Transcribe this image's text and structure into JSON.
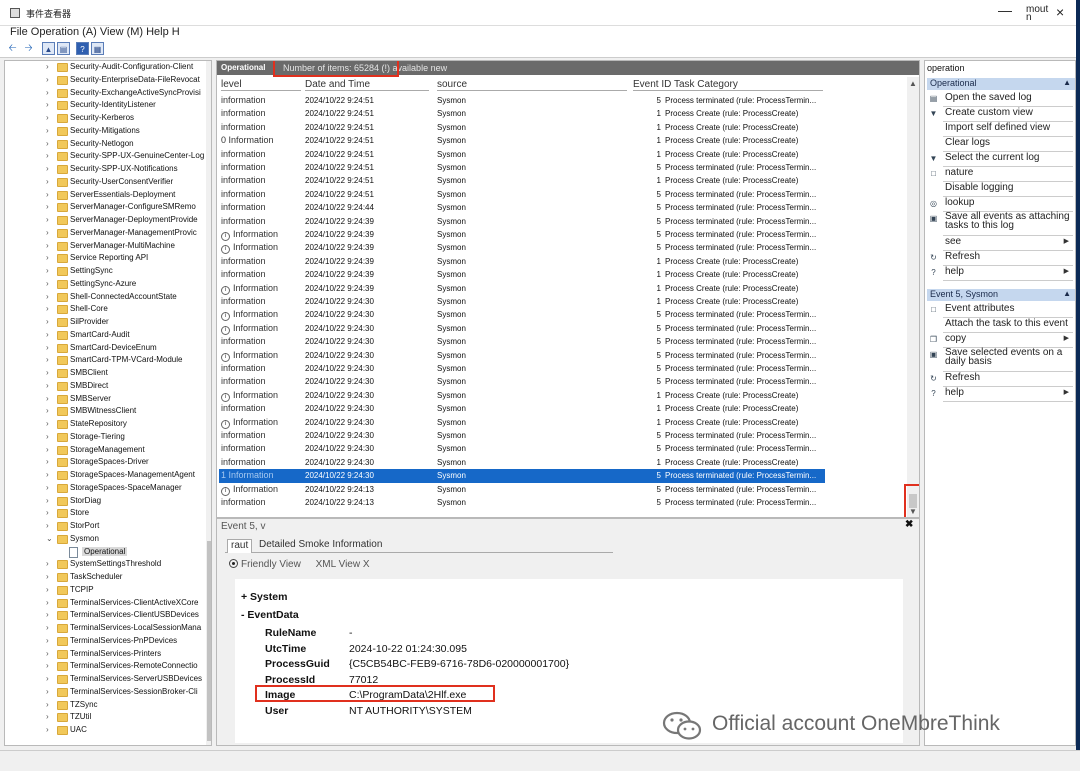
{
  "window": {
    "title": "事件查看器",
    "controls": {
      "minimize": "—",
      "maximize": "mout",
      "maximize_sub": "n",
      "close": "×"
    }
  },
  "menu": "File Operation (A) View (M) Help H",
  "toolbar": {
    "icons": [
      "back-arrow-icon",
      "forward-arrow-icon",
      "folder-up-icon",
      "show-hide-pane-icon",
      "help-icon",
      "properties-icon"
    ]
  },
  "tree": {
    "items": [
      "Security-Audit-Configuration-Client",
      "Security-EnterpriseData-FileRevocat",
      "Security-ExchangeActiveSyncProvisi",
      "Security-IdentityListener",
      "Security-Kerberos",
      "Security-Mitigations",
      "Security-Netlogon",
      "Security-SPP-UX-GenuineCenter-Log",
      "Security-SPP-UX-Notifications",
      "Security-UserConsentVerifier",
      "ServerEssentials-Deployment",
      "ServerManager-ConfigureSMRemo",
      "ServerManager-DeploymentProvide",
      "ServerManager-ManagementProvic",
      "ServerManager-MultiMachine",
      "Service Reporting API",
      "SettingSync",
      "SettingSync-Azure",
      "Shell-ConnectedAccountState",
      "Shell-Core",
      "SilProvider",
      "SmartCard-Audit",
      "SmartCard-DeviceEnum",
      "SmartCard-TPM-VCard-Module",
      "SMBClient",
      "SMBDirect",
      "SMBServer",
      "SMBWitnessClient",
      "StateRepository",
      "Storage-Tiering",
      "StorageManagement",
      "StorageSpaces-Driver",
      "StorageSpaces-ManagementAgent",
      "StorageSpaces-SpaceManager",
      "StorDiag",
      "Store",
      "StorPort",
      "Sysmon"
    ],
    "selected_child": "Operational",
    "items_after": [
      "SystemSettingsThreshold",
      "TaskScheduler",
      "TCPIP",
      "TerminalServices-ClientActiveXCore",
      "TerminalServices-ClientUSBDevices",
      "TerminalServices-LocalSessionMana",
      "TerminalServices-PnPDevices",
      "TerminalServices-Printers",
      "TerminalServices-RemoteConnectio",
      "TerminalServices-ServerUSBDevices",
      "TerminalServices-SessionBroker-Cli",
      "TZSync",
      "TZUtil",
      "UAC"
    ]
  },
  "log": {
    "tab": "Operational",
    "count": "Number of items: 65284 (!) available new",
    "columns": {
      "level": "level",
      "date": "Date and Time",
      "source": "source",
      "id_task": "Event ID Task Category"
    },
    "rows": [
      {
        "level": "information",
        "icon": false,
        "date": "2024/10/22 9:24:51",
        "source": "Sysmon",
        "id": "5",
        "task": "Process terminated (rule: ProcessTermin..."
      },
      {
        "level": "information",
        "icon": false,
        "date": "2024/10/22 9:24:51",
        "source": "Sysmon",
        "id": "1",
        "task": "Process Create (rule: ProcessCreate)"
      },
      {
        "level": "information",
        "icon": false,
        "date": "2024/10/22 9:24:51",
        "source": "Sysmon",
        "id": "1",
        "task": "Process Create (rule: ProcessCreate)"
      },
      {
        "level": "0 Information",
        "icon": false,
        "date": "2024/10/22 9:24:51",
        "source": "Sysmon",
        "id": "1",
        "task": "Process Create (rule: ProcessCreate)"
      },
      {
        "level": "information",
        "icon": false,
        "date": "2024/10/22 9:24:51",
        "source": "Sysmon",
        "id": "1",
        "task": "Process Create (rule: ProcessCreate)"
      },
      {
        "level": "information",
        "icon": false,
        "date": "2024/10/22 9:24:51",
        "source": "Sysmon",
        "id": "5",
        "task": "Process terminated (rule: ProcessTermin..."
      },
      {
        "level": "information",
        "icon": false,
        "date": "2024/10/22 9:24:51",
        "source": "Sysmon",
        "id": "1",
        "task": "Process Create (rule: ProcessCreate)"
      },
      {
        "level": "information",
        "icon": false,
        "date": "2024/10/22 9:24:51",
        "source": "Sysmon",
        "id": "5",
        "task": "Process terminated (rule: ProcessTermin..."
      },
      {
        "level": "information",
        "icon": false,
        "date": "2024/10/22 9:24:44",
        "source": "Sysmon",
        "id": "5",
        "task": "Process terminated (rule: ProcessTermin..."
      },
      {
        "level": "information",
        "icon": false,
        "date": "2024/10/22 9:24:39",
        "source": "Sysmon",
        "id": "5",
        "task": "Process terminated (rule: ProcessTermin..."
      },
      {
        "level": "Information",
        "icon": true,
        "date": "2024/10/22 9:24:39",
        "source": "Sysmon",
        "id": "5",
        "task": "Process terminated (rule: ProcessTermin..."
      },
      {
        "level": "Information",
        "icon": true,
        "date": "2024/10/22 9:24:39",
        "source": "Sysmon",
        "id": "5",
        "task": "Process terminated (rule: ProcessTermin..."
      },
      {
        "level": "information",
        "icon": false,
        "date": "2024/10/22 9:24:39",
        "source": "Sysmon",
        "id": "1",
        "task": "Process Create (rule: ProcessCreate)"
      },
      {
        "level": "information",
        "icon": false,
        "date": "2024/10/22 9:24:39",
        "source": "Sysmon",
        "id": "1",
        "task": "Process Create (rule: ProcessCreate)"
      },
      {
        "level": "Information",
        "icon": true,
        "date": "2024/10/22 9:24:39",
        "source": "Sysmon",
        "id": "1",
        "task": "Process Create (rule: ProcessCreate)"
      },
      {
        "level": "information",
        "icon": false,
        "date": "2024/10/22 9:24:30",
        "source": "Sysmon",
        "id": "1",
        "task": "Process Create (rule: ProcessCreate)"
      },
      {
        "level": "Information",
        "icon": true,
        "date": "2024/10/22 9:24:30",
        "source": "Sysmon",
        "id": "5",
        "task": "Process terminated (rule: ProcessTermin..."
      },
      {
        "level": "Information",
        "icon": true,
        "date": "2024/10/22 9:24:30",
        "source": "Sysmon",
        "id": "5",
        "task": "Process terminated (rule: ProcessTermin..."
      },
      {
        "level": "information",
        "icon": false,
        "date": "2024/10/22 9:24:30",
        "source": "Sysmon",
        "id": "5",
        "task": "Process terminated (rule: ProcessTermin..."
      },
      {
        "level": "Information",
        "icon": true,
        "date": "2024/10/22 9:24:30",
        "source": "Sysmon",
        "id": "5",
        "task": "Process terminated (rule: ProcessTermin..."
      },
      {
        "level": "information",
        "icon": false,
        "date": "2024/10/22 9:24:30",
        "source": "Sysmon",
        "id": "5",
        "task": "Process terminated (rule: ProcessTermin..."
      },
      {
        "level": "information",
        "icon": false,
        "date": "2024/10/22 9:24:30",
        "source": "Sysmon",
        "id": "5",
        "task": "Process terminated (rule: ProcessTermin..."
      },
      {
        "level": "Information",
        "icon": true,
        "date": "2024/10/22 9:24:30",
        "source": "Sysmon",
        "id": "1",
        "task": "Process Create (rule: ProcessCreate)"
      },
      {
        "level": "information",
        "icon": false,
        "date": "2024/10/22 9:24:30",
        "source": "Sysmon",
        "id": "1",
        "task": "Process Create (rule: ProcessCreate)"
      },
      {
        "level": "Information",
        "icon": true,
        "date": "2024/10/22 9:24:30",
        "source": "Sysmon",
        "id": "1",
        "task": "Process Create (rule: ProcessCreate)"
      },
      {
        "level": "information",
        "icon": false,
        "date": "2024/10/22 9:24:30",
        "source": "Sysmon",
        "id": "5",
        "task": "Process terminated (rule: ProcessTermin..."
      },
      {
        "level": "information",
        "icon": false,
        "date": "2024/10/22 9:24:30",
        "source": "Sysmon",
        "id": "5",
        "task": "Process terminated (rule: ProcessTermin..."
      },
      {
        "level": "information",
        "icon": false,
        "date": "2024/10/22 9:24:30",
        "source": "Sysmon",
        "id": "1",
        "task": "Process Create (rule: ProcessCreate)"
      },
      {
        "level": "1 Information",
        "icon": false,
        "date": "2024/10/22 9:24:30",
        "source": "Sysmon",
        "id": "5",
        "task": "Process terminated (rule: ProcessTermin...",
        "selected": true
      },
      {
        "level": "Information",
        "icon": true,
        "date": "2024/10/22 9:24:13",
        "source": "Sysmon",
        "id": "5",
        "task": "Process terminated (rule: ProcessTermin..."
      },
      {
        "level": "information",
        "icon": false,
        "date": "2024/10/22 9:24:13",
        "source": "Sysmon",
        "id": "5",
        "task": "Process terminated (rule: ProcessTermin..."
      }
    ]
  },
  "detail": {
    "title": "Event 5, v",
    "tabs": [
      "raut",
      "Detailed Smoke Information"
    ],
    "view_friendly": "Friendly View",
    "view_xml": "XML View X",
    "system_label": "+ System",
    "eventdata_label": "-  EventData",
    "fields": [
      {
        "k": "RuleName",
        "v": "-"
      },
      {
        "k": "UtcTime",
        "v": "2024-10-22 01:24:30.095"
      },
      {
        "k": "ProcessGuid",
        "v": "{C5CB54BC-FEB9-6716-78D6-020000001700}"
      },
      {
        "k": "ProcessId",
        "v": "77012"
      },
      {
        "k": "Image",
        "v": "C:\\ProgramData\\2Hlf.exe"
      },
      {
        "k": "User",
        "v": "NT AUTHORITY\\SYSTEM"
      }
    ]
  },
  "actions": {
    "header": "operation",
    "section1": "Operational",
    "items1": [
      {
        "t": "Open the saved log",
        "icon": "open-log-icon"
      },
      {
        "t": "Create custom view",
        "icon": "filter-icon"
      },
      {
        "t": "Import self defined view",
        "icon": ""
      },
      {
        "t": "Clear logs",
        "icon": ""
      },
      {
        "t": "Select the current log",
        "icon": "filter-icon"
      },
      {
        "t": "nature",
        "icon": "properties-icon"
      },
      {
        "t": "Disable logging",
        "icon": ""
      },
      {
        "t": "lookup",
        "icon": "binoculars-icon"
      },
      {
        "t": "Save all events as attaching tasks to this log",
        "icon": "save-icon"
      },
      {
        "t": "see",
        "icon": "",
        "sub": true
      },
      {
        "t": "Refresh",
        "icon": "refresh-icon"
      },
      {
        "t": "help",
        "icon": "help-icon",
        "sub": true
      }
    ],
    "section2": "Event 5, Sysmon",
    "items2": [
      {
        "t": "Event attributes",
        "icon": "properties-icon"
      },
      {
        "t": "Attach the task to this event",
        "icon": ""
      },
      {
        "t": "copy",
        "icon": "copy-icon",
        "sub": true
      },
      {
        "t": "Save selected events on a daily basis",
        "icon": "save-icon"
      },
      {
        "t": "Refresh",
        "icon": "refresh-icon"
      },
      {
        "t": "help",
        "icon": "help-icon",
        "sub": true
      }
    ]
  },
  "watermark": "Official account OneMbreThink",
  "colors": {
    "selection": "#1668c8",
    "highlight_box": "#e0301e",
    "section_header": "#c5d7ee",
    "log_header": "#6a6a6a"
  }
}
